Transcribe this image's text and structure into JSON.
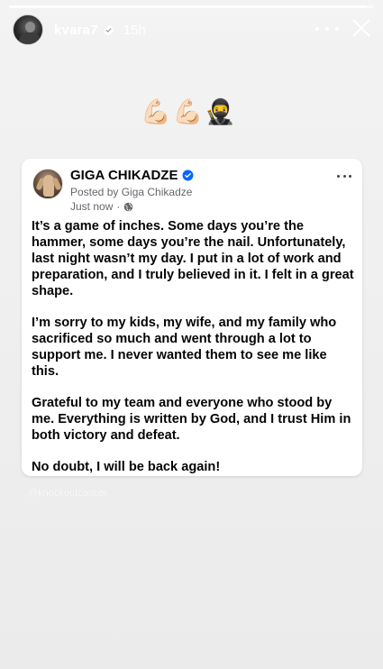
{
  "story": {
    "progress": 0.98,
    "username": "kvara7",
    "time": "15h",
    "emojis": [
      "💪🏻",
      "💪🏻",
      "🥷"
    ]
  },
  "post": {
    "author": "GIGA CHIKADZE",
    "posted_by": "Posted by Giga Chikadze",
    "timestamp": "Just now",
    "separator": "·",
    "paragraphs": [
      "It’s a game of inches. Some days you’re the hammer, some days you’re the nail. Unfortunately, last night wasn’t my day. I put in a lot of work and preparation, and I truly believed in it. I felt in a great shape.",
      "I’m sorry to my kids, my wife, and my family who sacrificed so much and went through a lot to support me. I never wanted them to see me like this.",
      "Grateful to my team and everyone who stood by me. Everything is written by God, and I trust Him in both victory and defeat.",
      "No doubt, I will be back again!"
    ]
  },
  "watermark": "@knockoutcancer",
  "icons": {
    "verified": "verified-badge-icon",
    "more": "more-horizontal-icon",
    "close": "close-icon",
    "globe": "globe-icon"
  },
  "colors": {
    "verified_blue": "#0866ff",
    "text_primary": "#050505",
    "text_secondary": "#65676b"
  }
}
